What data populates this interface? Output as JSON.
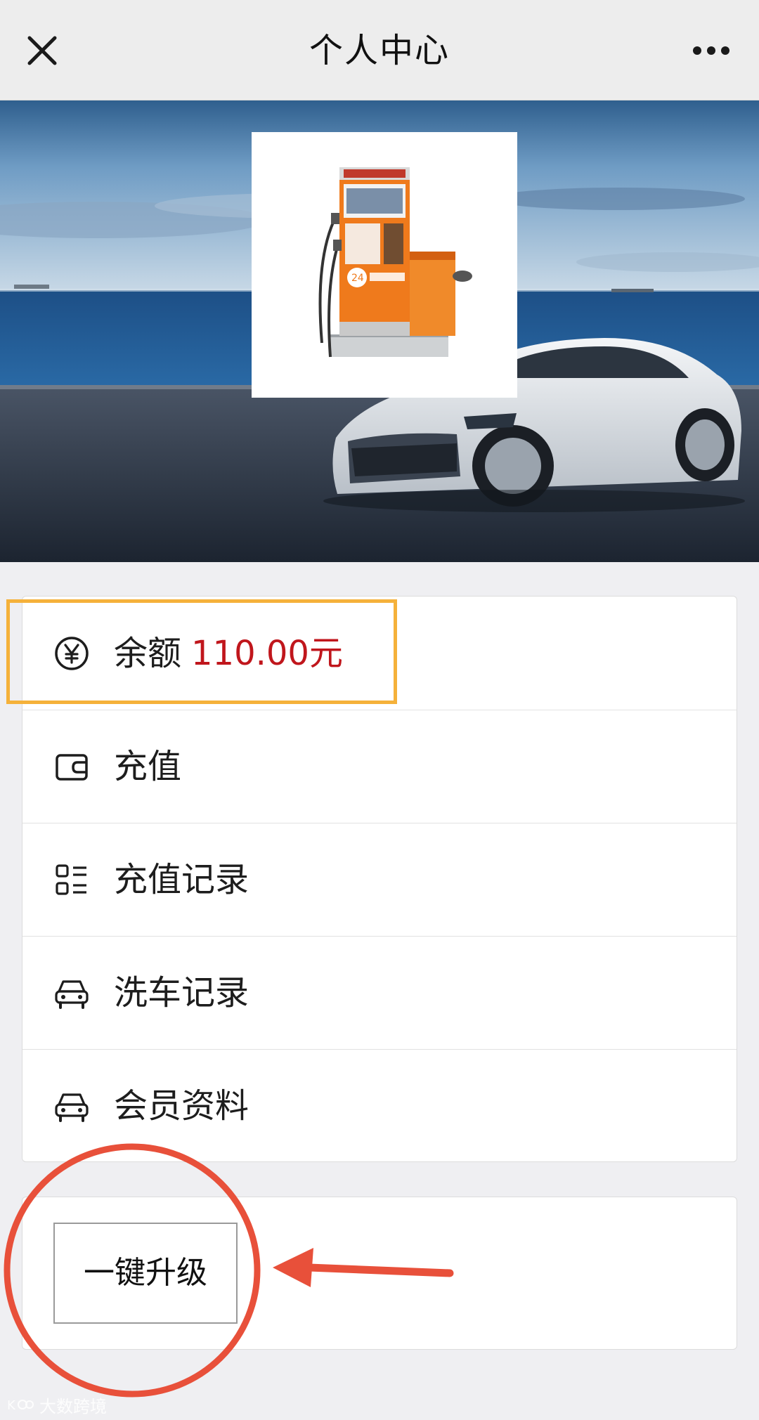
{
  "header": {
    "title": "个人中心",
    "close_icon": "close-icon",
    "more_icon": "more-icon"
  },
  "banner": {
    "product_image": "car-wash-machine",
    "background_image": "sports-car-seaside"
  },
  "menu": {
    "items": [
      {
        "icon": "yen-icon",
        "label": "余额",
        "value": "110.00元"
      },
      {
        "icon": "wallet-icon",
        "label": "充值"
      },
      {
        "icon": "list-icon",
        "label": "充值记录"
      },
      {
        "icon": "car-icon",
        "label": "洗车记录"
      },
      {
        "icon": "car-icon",
        "label": "会员资料"
      }
    ]
  },
  "upgrade": {
    "button_label": "一键升级"
  },
  "annotations": {
    "highlight_color": "#f5b13a",
    "circle_color": "#e8503a",
    "amount_color": "#c0161c"
  },
  "watermark": {
    "text": "大数跨境"
  }
}
